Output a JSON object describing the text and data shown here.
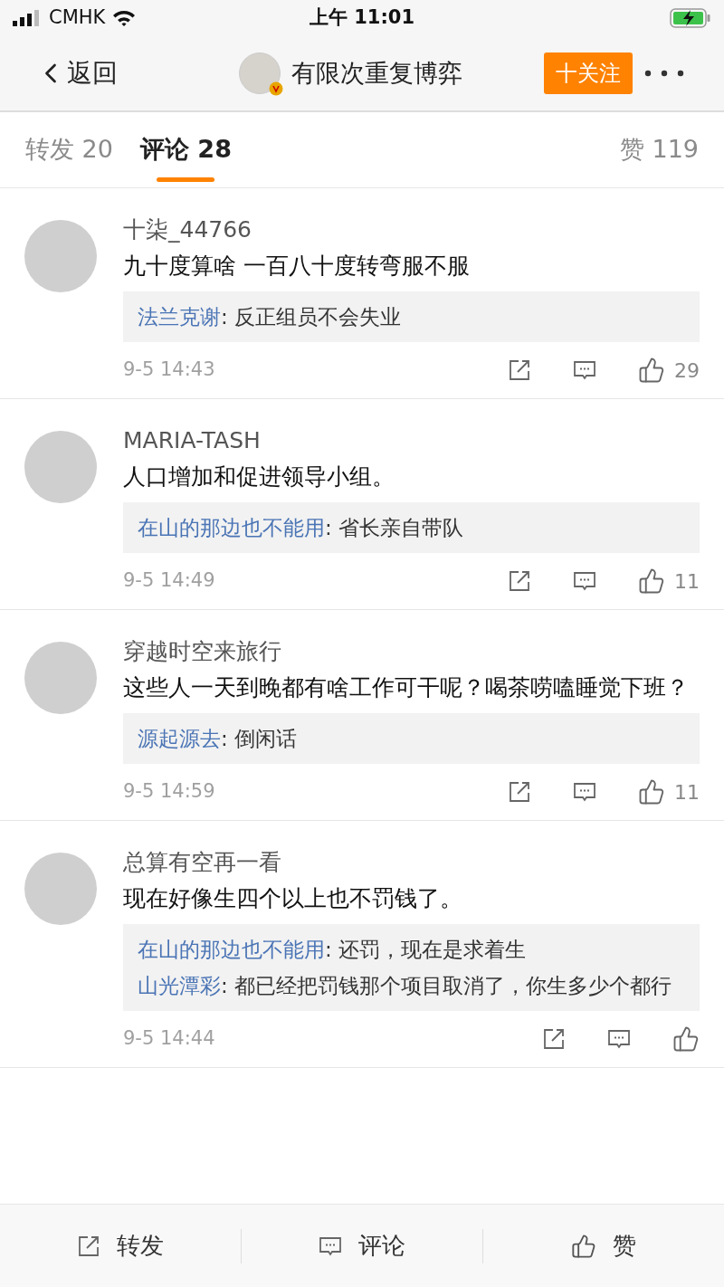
{
  "status_bar": {
    "carrier": "CMHK",
    "time": "上午 11:01",
    "charging": true
  },
  "nav": {
    "back": "返回",
    "title": "有限次重复博弈",
    "verified": true,
    "follow": "十关注"
  },
  "tabs": [
    {
      "label": "转发",
      "count": "20",
      "selected": false
    },
    {
      "label": "评论",
      "count": "28",
      "selected": true
    },
    {
      "label": "赞",
      "count": "119",
      "selected": false
    }
  ],
  "comments": [
    {
      "user": "十柒_44766",
      "text": "九十度算啥 一百八十度转弯服不服",
      "replies": [
        {
          "user": "法兰克谢",
          "text": ": 反正组员不会失业"
        }
      ],
      "time": "9-5 14:43",
      "likes": "29"
    },
    {
      "user": "MARIA-TASH",
      "text": "人口增加和促进领导小组。",
      "replies": [
        {
          "user": "在山的那边也不能用",
          "text": ": 省长亲自带队"
        }
      ],
      "time": "9-5 14:49",
      "likes": "11"
    },
    {
      "user": "穿越时空来旅行",
      "text": "这些人一天到晚都有啥工作可干呢？喝茶唠嗑睡觉下班？",
      "replies": [
        {
          "user": "源起源去",
          "text": ": 倒闲话"
        }
      ],
      "time": "9-5 14:59",
      "likes": "11"
    },
    {
      "user": "总算有空再一看",
      "text": "现在好像生四个以上也不罚钱了。",
      "replies": [
        {
          "user": "在山的那边也不能用",
          "text": ": 还罚，现在是求着生"
        },
        {
          "user": "山光潭彩",
          "text": ": 都已经把罚钱那个项目取消了，你生多少个都行"
        }
      ],
      "time": "9-5 14:44"
    }
  ],
  "bottom_bar": [
    {
      "kind": "repost",
      "label": "转发"
    },
    {
      "kind": "comment",
      "label": "评论"
    },
    {
      "kind": "like",
      "label": "赞"
    }
  ]
}
